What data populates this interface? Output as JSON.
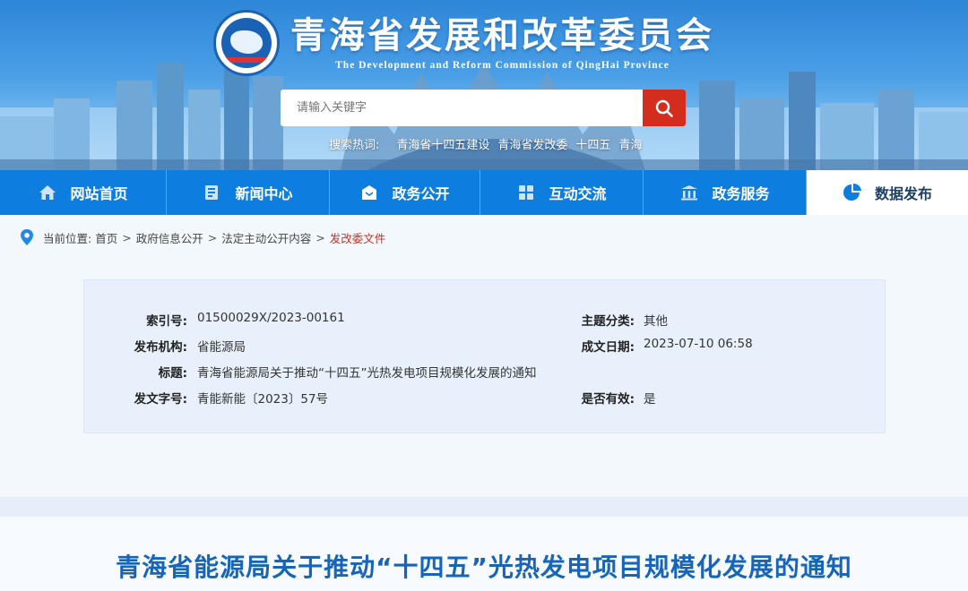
{
  "site": {
    "title_cn": "青海省发展和改革委员会",
    "title_en": "The Development and Reform Commission of QingHai Province"
  },
  "search": {
    "placeholder": "请输入关键字",
    "hot_label": "搜索热词:",
    "hot_words": [
      "青海省十四五建设",
      "青海省发改委",
      "十四五",
      "青海"
    ]
  },
  "nav": {
    "items": [
      {
        "label": "网站首页",
        "icon": "home-icon"
      },
      {
        "label": "新闻中心",
        "icon": "news-icon"
      },
      {
        "label": "政务公开",
        "icon": "open-government-icon"
      },
      {
        "label": "互动交流",
        "icon": "interaction-icon"
      },
      {
        "label": "政务服务",
        "icon": "service-building-icon"
      },
      {
        "label": "数据发布",
        "icon": "pie-chart-icon"
      }
    ],
    "active_index": 5
  },
  "breadcrumb": {
    "label": "当前位置:",
    "items": [
      "首页",
      "政府信息公开",
      "法定主动公开内容"
    ],
    "current": "发改委文件"
  },
  "info": {
    "index_no": {
      "label": "索引号:",
      "value": "01500029X/2023-00161"
    },
    "topic": {
      "label": "主题分类:",
      "value": "其他"
    },
    "publisher": {
      "label": "发布机构:",
      "value": "省能源局"
    },
    "date": {
      "label": "成文日期:",
      "value": "2023-07-10 06:58"
    },
    "title": {
      "label": "标题:",
      "value": "青海省能源局关于推动“十四五”光热发电项目规模化发展的通知"
    },
    "doc_no": {
      "label": "发文字号:",
      "value": "青能新能〔2023〕57号"
    },
    "valid": {
      "label": "是否有效:",
      "value": "是"
    }
  },
  "article": {
    "title": "青海省能源局关于推动“十四五”光热发电项目规模化发展的通知"
  },
  "colors": {
    "nav_blue": "#0d7de0",
    "search_red": "#d42d1e",
    "title_blue": "#1665b8",
    "current_red": "#d42d1e"
  }
}
